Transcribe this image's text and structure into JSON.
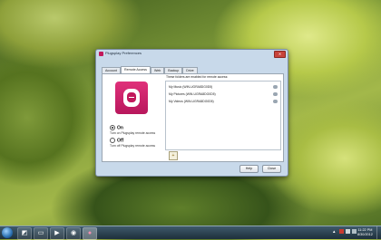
{
  "window": {
    "title": "Plugsplay Preferences",
    "tabs": [
      "Account",
      "Remote Access",
      "Web",
      "Backup",
      "Drive"
    ],
    "active_tab_index": 1
  },
  "remote_access": {
    "folders_heading": "These folders are enabled for remote access:",
    "folders": [
      "My Music (WIN-UGRA8DG0D5)",
      "My Pictures (WIN-UGRA8DG0D5)",
      "My Videos (WIN-UGRA8DG0D5)"
    ],
    "on_label": "On",
    "on_desc": "Turn on Plugsplay remote access",
    "off_label": "Off",
    "off_desc": "Turn off Plugsplay remote access",
    "selected": "On"
  },
  "buttons": {
    "help": "Help",
    "close": "Close",
    "add_icon": "add-folder-icon"
  },
  "taskbar": {
    "time": "11:22 PM",
    "date": "8/30/2012",
    "icons": [
      "windows-explorer-icon",
      "folder-icon",
      "media-player-icon",
      "chrome-icon",
      "plugsplay-icon"
    ]
  },
  "colors": {
    "brand": "#c2185b",
    "taskbar": "#2a4150"
  }
}
